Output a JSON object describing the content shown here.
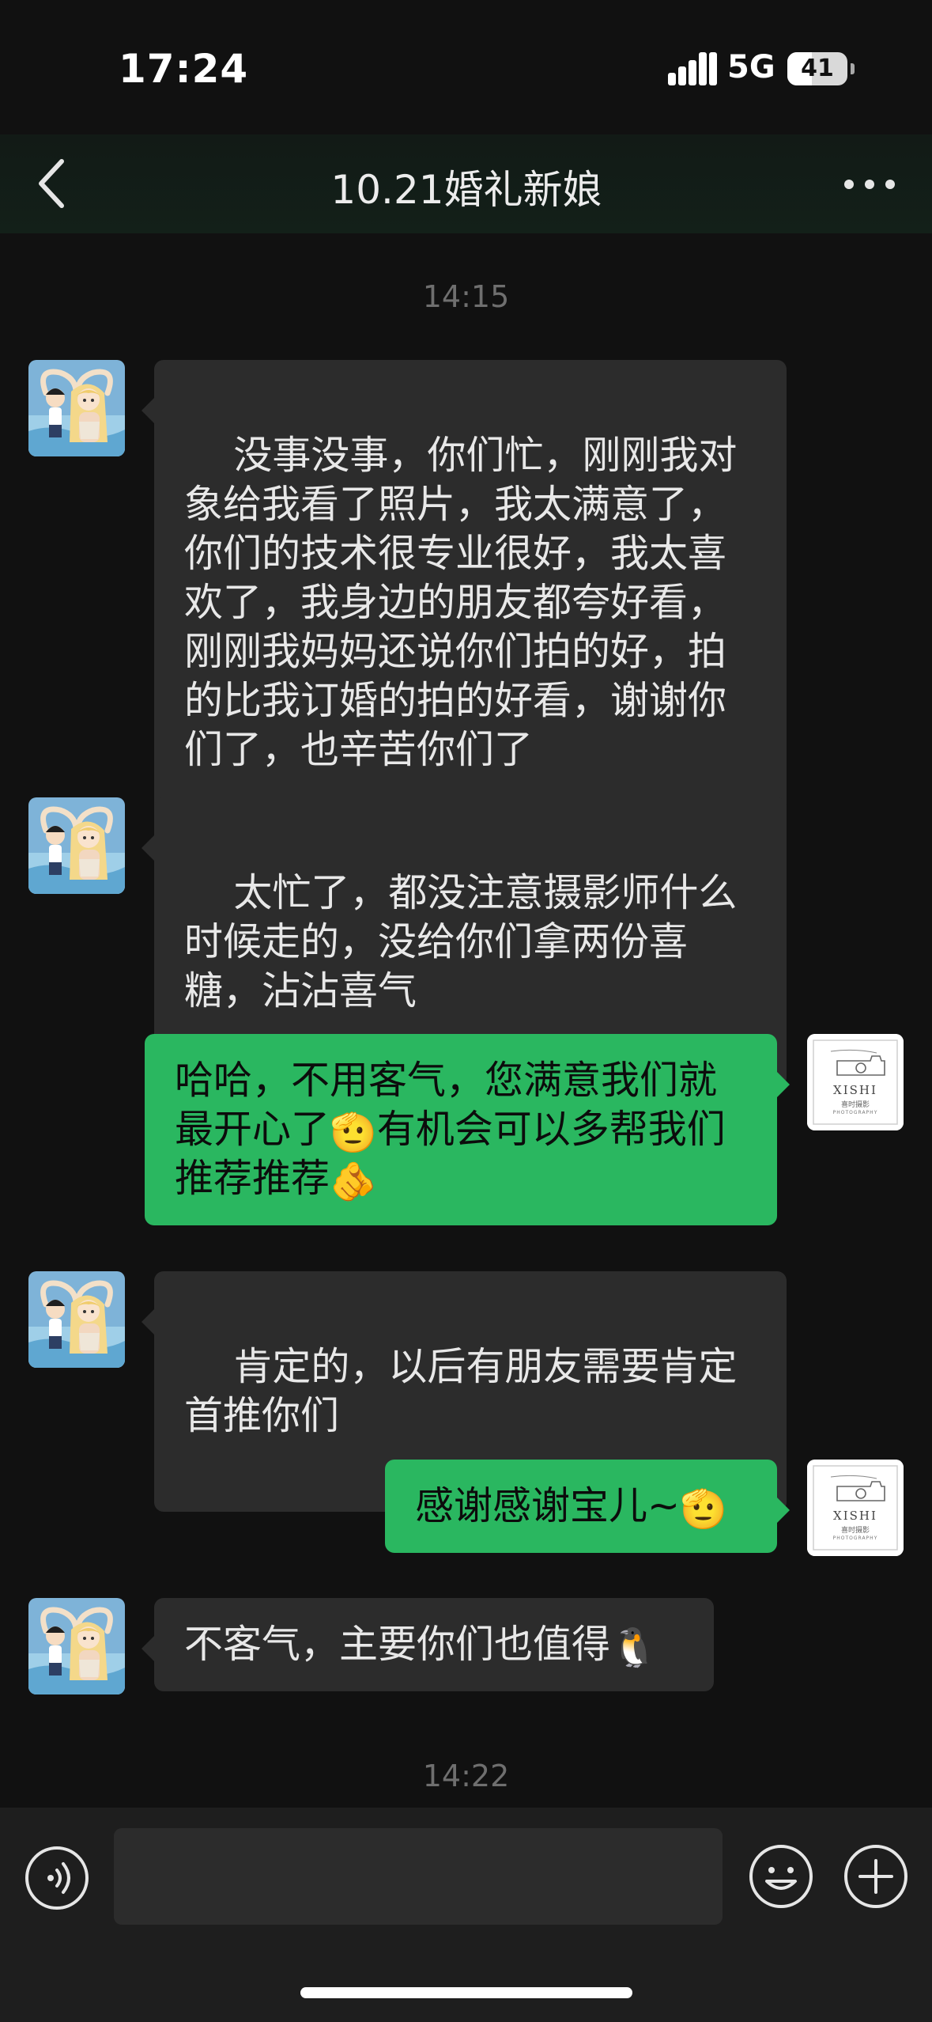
{
  "status_bar": {
    "time": "17:24",
    "network": "5G",
    "battery": "41",
    "battery_level": 0.41
  },
  "nav": {
    "title": "10.21婚礼新娘"
  },
  "chat": {
    "timestamp_top": "14:15",
    "timestamp_bottom": "14:22",
    "messages": [
      {
        "sender": "other",
        "text": "没事没事，你们忙，刚刚我对象给我看了照片，我太满意了，你们的技术很专业很好，我太喜欢了，我身边的朋友都夸好看，刚刚我妈妈还说你们拍的好，拍的比我订婚的拍的好看，谢谢你们了，也辛苦你们了"
      },
      {
        "sender": "other",
        "text": "太忙了，都没注意摄影师什么时候走的，没给你们拿两份喜糖，沾沾喜气"
      },
      {
        "sender": "me",
        "text_1": "哈哈，不用客气，您满意我们就最开心了",
        "emoji_1": "🫡",
        "text_2": "有机会可以多帮我们推荐推荐",
        "emoji_2": "🫵"
      },
      {
        "sender": "other",
        "text": "肯定的，以后有朋友需要肯定首推你们"
      },
      {
        "sender": "me",
        "text": "感谢感谢宝儿~",
        "emoji": "🫡"
      },
      {
        "sender": "other",
        "text": "不客气，主要你们也值得",
        "emoji": "🐧"
      }
    ],
    "my_avatar": {
      "brand": "XISHI",
      "brand_sub": "喜时摄影",
      "brand_tag": "PHOTOGRAPHY"
    }
  },
  "input_bar": {
    "value": "",
    "placeholder": ""
  },
  "icons": {
    "back": "chevron-left-icon",
    "more": "more-dots-icon",
    "voice": "voice-icon",
    "emoji": "emoji-icon",
    "plus": "plus-icon"
  },
  "colors": {
    "background": "#111111",
    "bubble_other": "#2c2c2c",
    "bubble_me": "#2ab760",
    "input_bar": "#1e1e1e"
  }
}
